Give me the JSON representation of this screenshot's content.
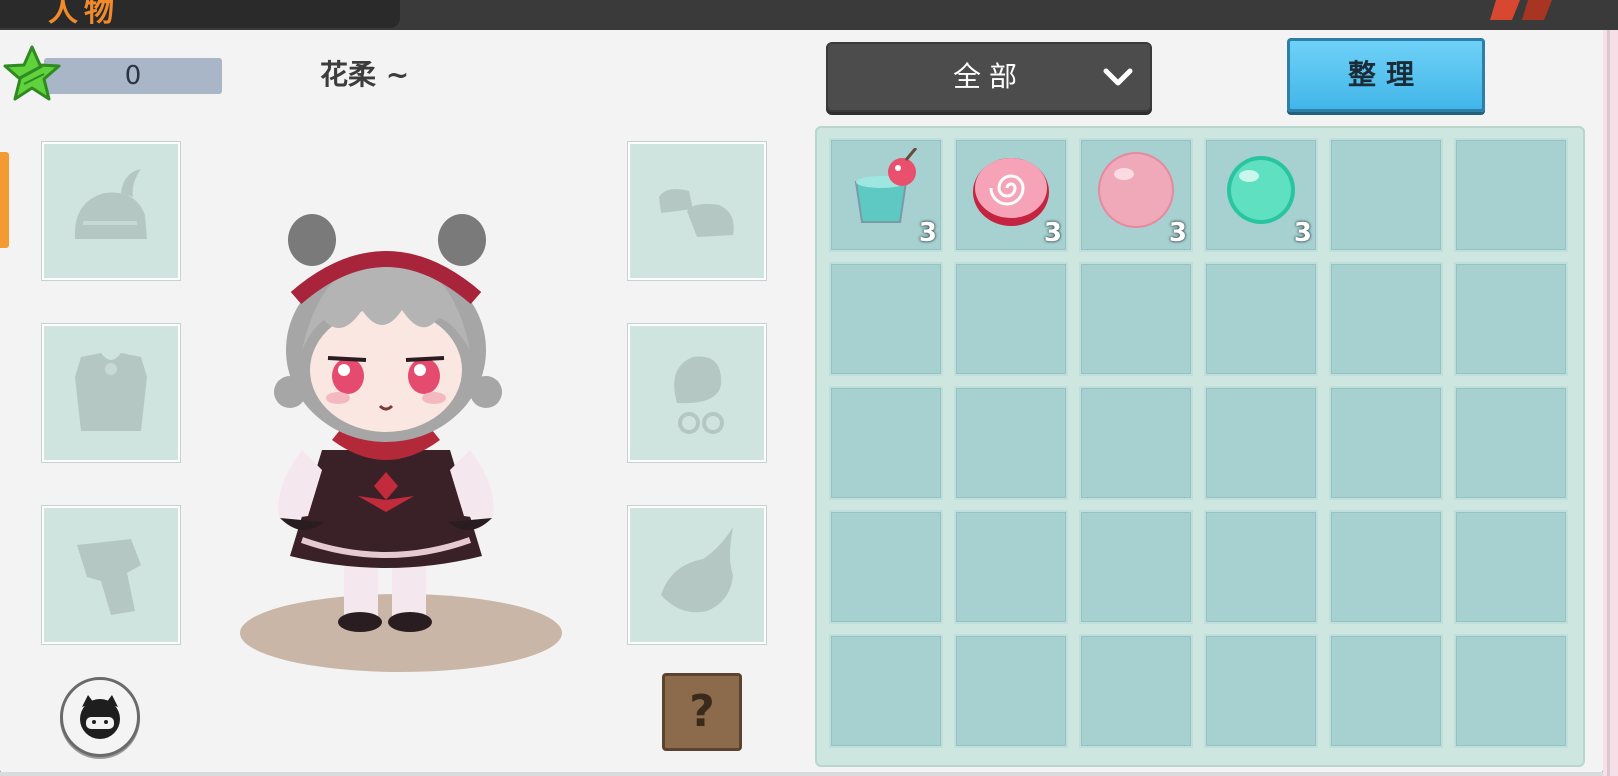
{
  "header": {
    "title_peek": "人物"
  },
  "player": {
    "star_count": "0",
    "name": "花柔 ~"
  },
  "equipment": {
    "left": [
      "helmet-icon",
      "chest-armor-icon",
      "leg-armor-icon"
    ],
    "right": [
      "boots-icon",
      "face-accessory-icon",
      "back-accessory-icon"
    ]
  },
  "bottom": {
    "help_label": "?"
  },
  "filter": {
    "selected": "全部"
  },
  "sort_button": {
    "label": "整理"
  },
  "inventory": {
    "columns": 6,
    "rows": 5,
    "items": [
      {
        "icon": "drink-cup-icon",
        "count": "3"
      },
      {
        "icon": "candy-swirl-icon",
        "count": "3"
      },
      {
        "icon": "pink-orb-icon",
        "count": "3"
      },
      {
        "icon": "green-orb-icon",
        "count": "3"
      }
    ]
  },
  "colors": {
    "accent": "#f39a32",
    "slot": "#a6d1d0",
    "sort_button": "#4fc0ef"
  }
}
